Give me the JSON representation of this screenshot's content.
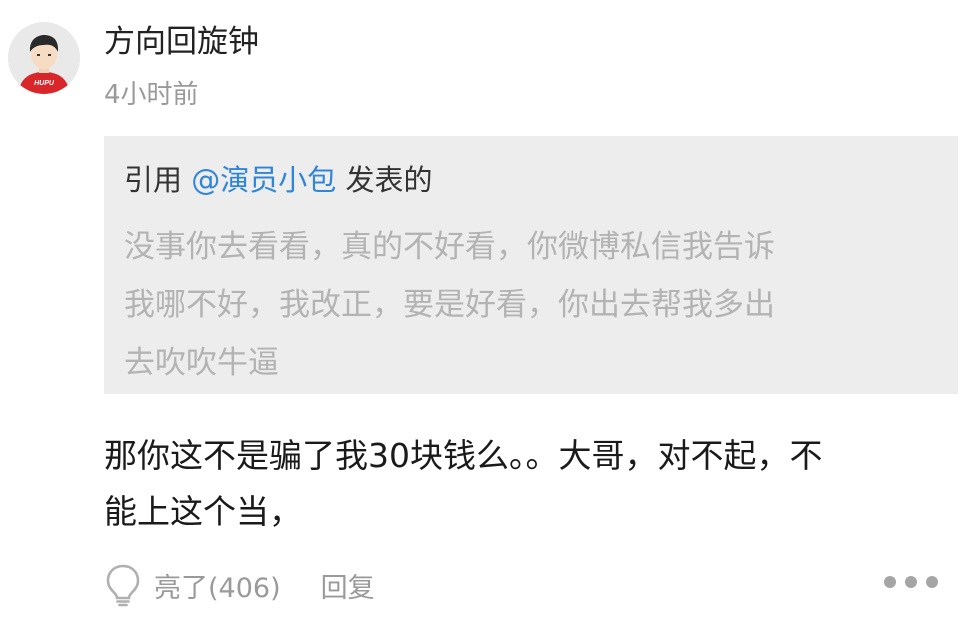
{
  "post": {
    "username": "方向回旋钟",
    "time": "4小时前",
    "avatar_badge": "HUPU",
    "quote": {
      "prefix": "引用 ",
      "author": "@演员小包",
      "suffix": " 发表的",
      "lines": [
        "没事你去看看，真的不好看，你微博私信我告诉",
        "我哪不好，我改正，要是好看，你出去帮我多出",
        "去吹吹牛逼"
      ]
    },
    "comment_lines": [
      "那你这不是骗了我30块钱么。。大哥，对不起，不",
      "能上这个当，"
    ],
    "actions": {
      "like_label": "亮了(406)",
      "reply_label": "回复"
    }
  },
  "colors": {
    "quote_background": "#ededed",
    "mention_blue": "#2f86d9",
    "muted_gray": "#9a9a9a",
    "avatar_shirt_red": "#d9262b"
  },
  "icons": [
    "avatar",
    "lightbulb-icon",
    "more-icon"
  ]
}
